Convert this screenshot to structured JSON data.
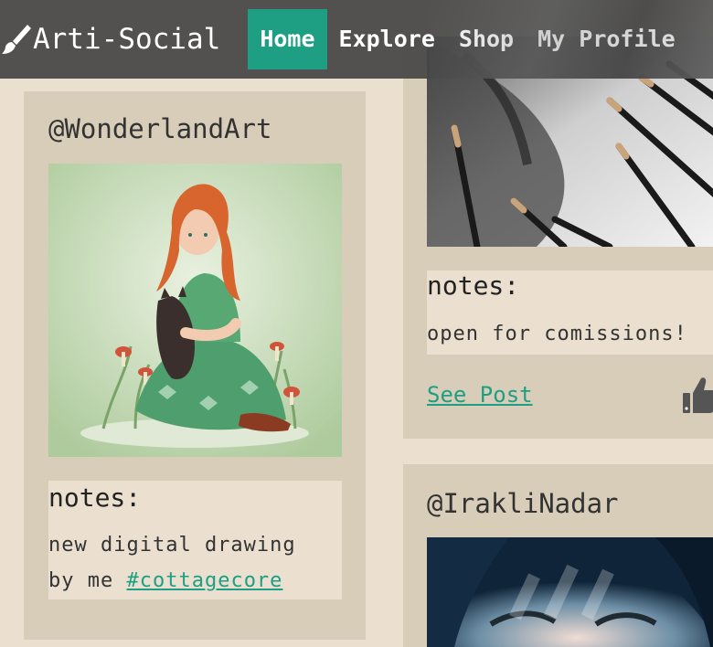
{
  "nav": {
    "brand": "Arti-Social",
    "brand_icon": "paintbrush-icon",
    "items": [
      {
        "label": "Home",
        "active": true
      },
      {
        "label": "Explore",
        "active": false
      },
      {
        "label": "Shop",
        "active": false
      },
      {
        "label": "My Profile",
        "active": false
      }
    ]
  },
  "posts": [
    {
      "handle": "@WonderlandArt",
      "image": "illustration of red-haired girl in green dress holding a black cat",
      "notes_title": "notes:",
      "notes_text": "new digital drawing by me",
      "tag": "#cottagecore"
    },
    {
      "image": "graphite pencil drawing with pencils",
      "notes_title": "notes:",
      "notes_text": "open for comissions!",
      "link": "See Post",
      "like_icon": "thumbs-up-icon"
    },
    {
      "handle": "@IrakliNadar",
      "image": "portrait photo with shadow pattern on face"
    }
  ],
  "colors": {
    "accent": "#1e9e83",
    "navbar": "#464646",
    "page_bg": "#ebe0cf",
    "card_bg": "#d8cdb8"
  }
}
